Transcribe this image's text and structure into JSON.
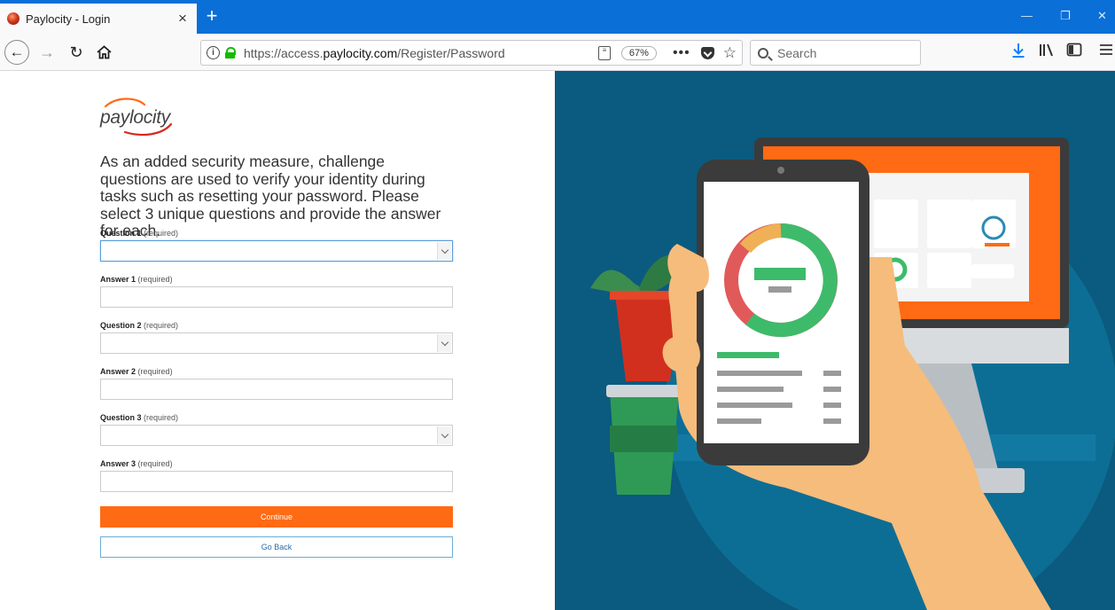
{
  "browser": {
    "tab_title": "Paylocity - Login",
    "tab_close": "×",
    "new_tab": "+",
    "url_prefix": "https://access.",
    "url_domain": "paylocity.com",
    "url_path": "/Register/Password",
    "zoom": "67%",
    "more_actions": "•••",
    "search_placeholder": "Search",
    "minimize": "—",
    "restore": "❐",
    "close": "✕"
  },
  "page": {
    "logo_text": "paylocity",
    "intro": "As an added security measure, challenge questions are used to verify your identity during tasks such as resetting your password. Please select 3 unique questions and provide the answer for each.",
    "required_note": "(required)",
    "fields": [
      {
        "label": "Question 1",
        "type": "select"
      },
      {
        "label": "Answer 1",
        "type": "text"
      },
      {
        "label": "Question 2",
        "type": "select"
      },
      {
        "label": "Answer 2",
        "type": "text"
      },
      {
        "label": "Question 3",
        "type": "select"
      },
      {
        "label": "Answer 3",
        "type": "text"
      }
    ],
    "continue_label": "Continue",
    "goback_label": "Go Back"
  },
  "colors": {
    "accent_orange": "#ff6a14",
    "browser_blue": "#0a6fd6",
    "illustration_bg": "#0b5a80"
  }
}
